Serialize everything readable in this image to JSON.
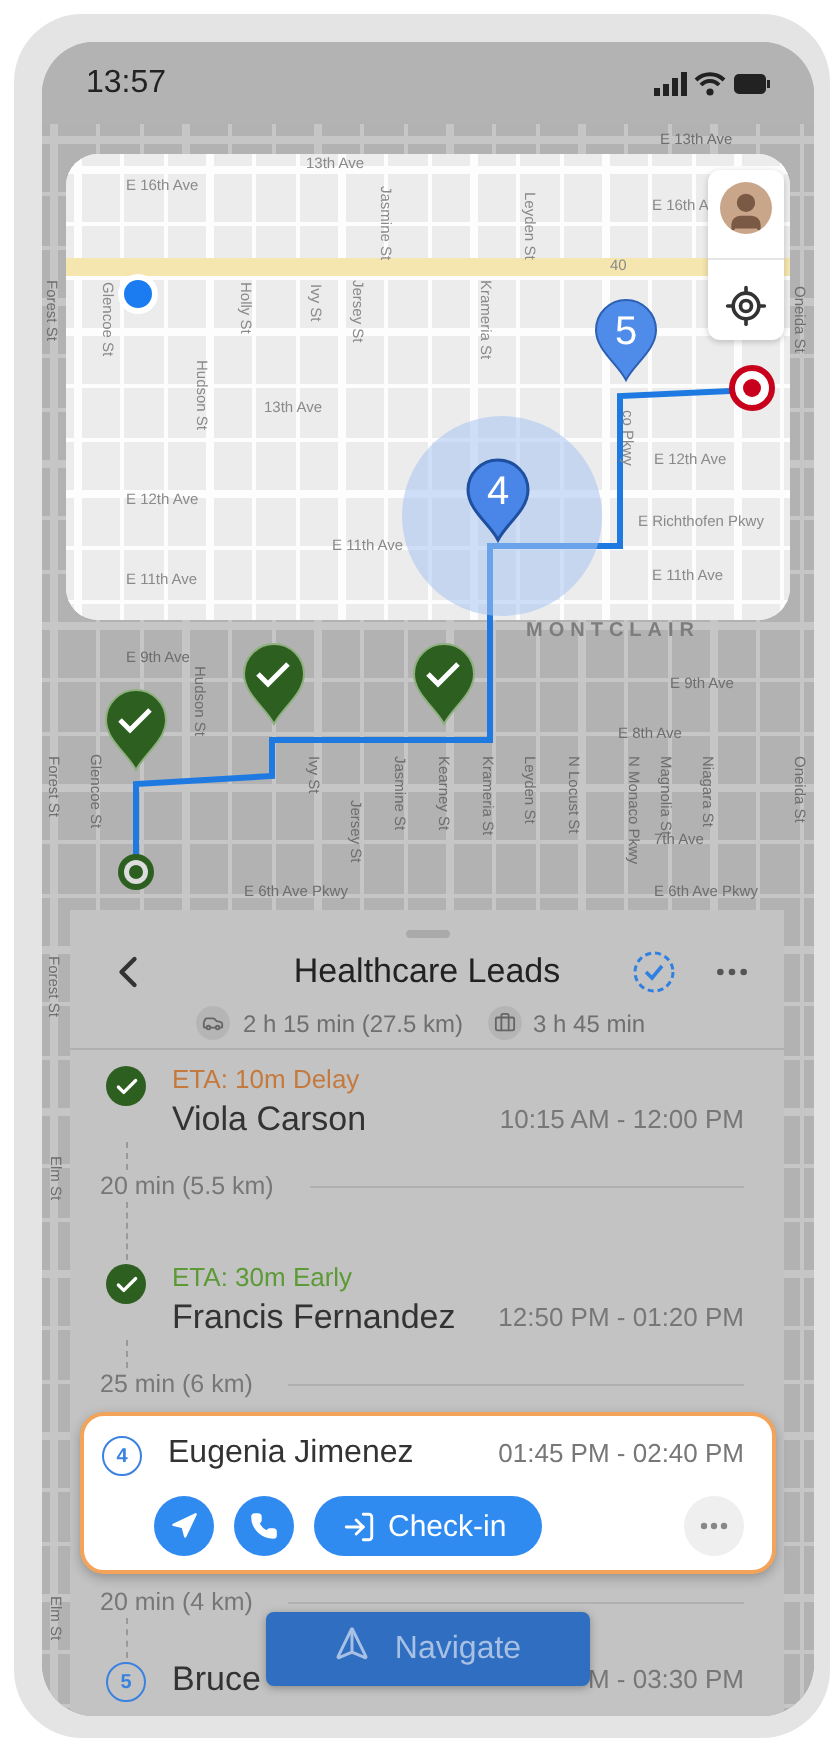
{
  "status_bar": {
    "time": "13:57"
  },
  "map": {
    "labels": [
      "E 13th Ave",
      "13th Ave",
      "E 16th Ave",
      "E 16th A",
      "Jasmine St",
      "Leyden St",
      "Holly St",
      "Ivy St",
      "Jersey St",
      "Krameria St",
      "Glencoe St",
      "Hudson St",
      "13th Ave",
      "co Pkwy",
      "E 12th Ave",
      "E 12th Ave",
      "E Richthofen Pkwy",
      "E 11th Ave",
      "E 11th Ave",
      "E 11th Ave",
      "MONTCLAIR",
      "E 9th Ave",
      "E 9th Ave",
      "E 8th Ave",
      "Oneida St",
      "Forest St",
      "Forest St",
      "Glencoe St",
      "Hudson St",
      "Ivy St",
      "Jersey St",
      "Jasmine St",
      "Kearney St",
      "Krameria St",
      "Leyden St",
      "N Locust St",
      "N Monaco Pkwy",
      "Magnolia St",
      "Niagara St",
      "Oneida St",
      "7th Ave",
      "E 6th Ave Pkwy",
      "E 6th Ave Pkwy",
      "Forest St",
      "Elm St",
      "Elm St",
      "40"
    ],
    "pins": [
      {
        "kind": "done",
        "selected": false
      },
      {
        "kind": "done",
        "selected": false
      },
      {
        "kind": "done",
        "selected": false
      },
      {
        "kind": "numbered",
        "label": "5",
        "selected": false
      },
      {
        "kind": "numbered",
        "label": "4",
        "selected": true
      }
    ]
  },
  "route_name": "Healthcare Leads",
  "summary": {
    "drive": "2 h 15 min (27.5 km)",
    "work": "3 h 45 min"
  },
  "stops": [
    {
      "kind": "done",
      "selected": false,
      "eta": "ETA: 10m Delay",
      "color": "#c47a3e",
      "name": "Viola Carson",
      "time": "10:15 AM - 12:00 PM",
      "leg": "20 min (5.5 km)"
    },
    {
      "kind": "done",
      "selected": false,
      "eta": "ETA: 30m Early",
      "color": "#5c9a36",
      "name": "Francis Fernandez",
      "time": "12:50 PM - 01:20 PM",
      "leg": "25 min (6 km)"
    },
    {
      "kind": "numbered",
      "selected": true,
      "number": "4",
      "name": "Eugenia Jimenez",
      "time": "01:45 PM - 02:40 PM",
      "action": "Check-in",
      "leg": "20 min (4 km)"
    },
    {
      "kind": "numbered",
      "selected": false,
      "number": "5",
      "name": "Bruce",
      "time": "M - 03:30 PM"
    }
  ],
  "navigate_button": "Navigate"
}
